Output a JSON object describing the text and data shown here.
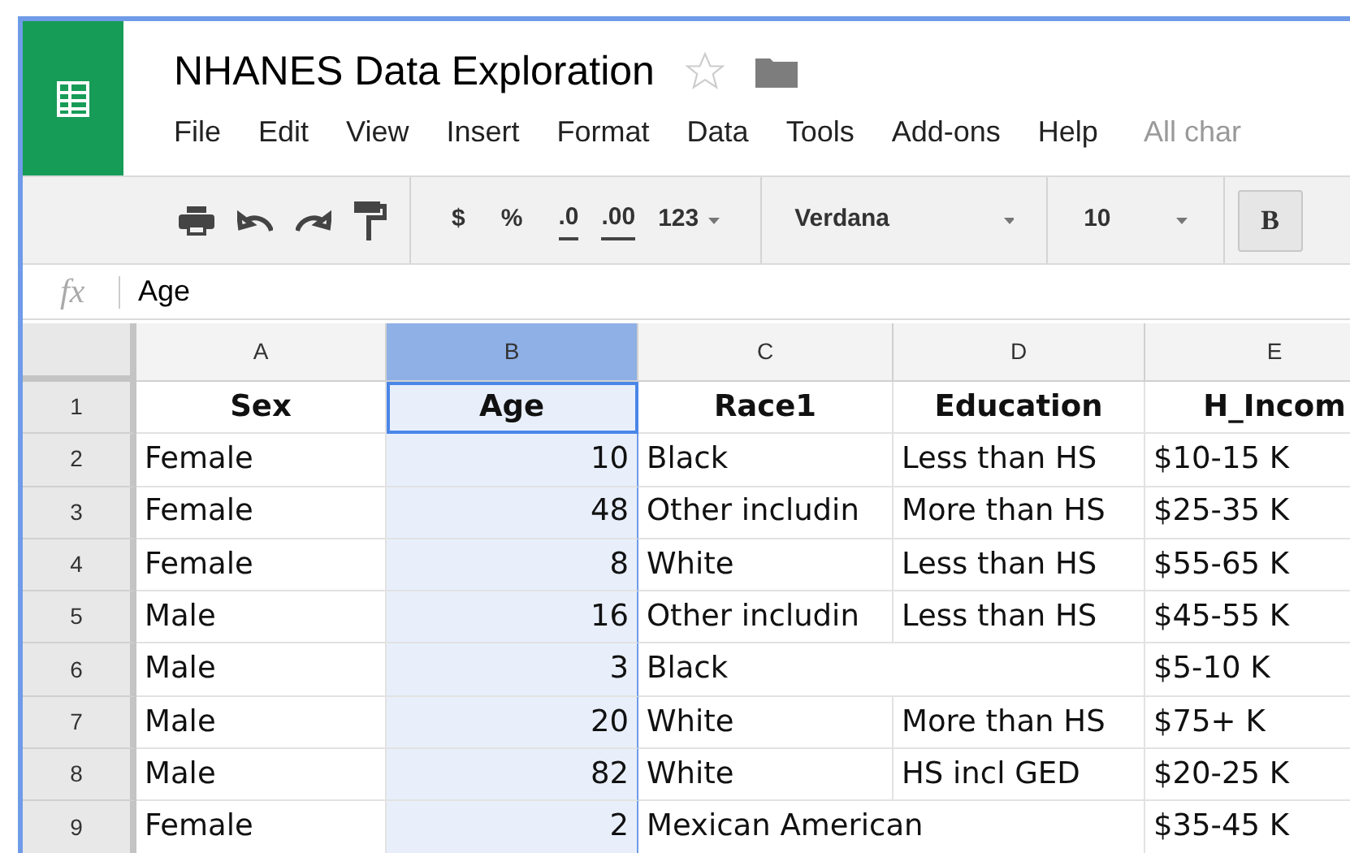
{
  "document": {
    "title": "NHANES Data Exploration",
    "starred": false
  },
  "menu": [
    "File",
    "Edit",
    "View",
    "Insert",
    "Format",
    "Data",
    "Tools",
    "Add-ons",
    "Help"
  ],
  "save_status": "All char",
  "toolbar": {
    "currency": "$",
    "percent": "%",
    "decrease_decimals": ".0",
    "increase_decimals": ".00",
    "more_formats": "123",
    "font": "Verdana",
    "font_size": "10",
    "bold": "B"
  },
  "formula_bar": {
    "label": "fx",
    "value": "Age"
  },
  "columns": [
    {
      "letter": "A",
      "kind": "text",
      "selected": false
    },
    {
      "letter": "B",
      "kind": "number",
      "selected": true
    },
    {
      "letter": "C",
      "kind": "text",
      "selected": false
    },
    {
      "letter": "D",
      "kind": "text",
      "selected": false
    },
    {
      "letter": "E",
      "kind": "text",
      "selected": false
    }
  ],
  "rows": [
    {
      "number": "1",
      "kind": "header",
      "active": true,
      "cells": [
        "Sex",
        "Age",
        "Race1",
        "Education",
        "H_Incom"
      ]
    },
    {
      "number": "2",
      "kind": "data",
      "active": false,
      "cells": [
        "Female",
        "10",
        "Black",
        "Less than HS",
        "$10-15 K"
      ]
    },
    {
      "number": "3",
      "kind": "data",
      "active": false,
      "cells": [
        "Female",
        "48",
        "Other includin",
        "More than HS",
        "$25-35 K"
      ]
    },
    {
      "number": "4",
      "kind": "data",
      "active": false,
      "cells": [
        "Female",
        "8",
        "White",
        "Less than HS",
        "$55-65 K"
      ]
    },
    {
      "number": "5",
      "kind": "data",
      "active": false,
      "cells": [
        "Male",
        "16",
        "Other includin",
        "Less than HS",
        "$45-55 K"
      ]
    },
    {
      "number": "6",
      "kind": "data",
      "active": false,
      "cells": [
        "Male",
        "3",
        "Black",
        "",
        "$5-10 K"
      ]
    },
    {
      "number": "7",
      "kind": "data",
      "active": false,
      "cells": [
        "Male",
        "20",
        "White",
        "More than HS",
        "$75+ K"
      ]
    },
    {
      "number": "8",
      "kind": "data",
      "active": false,
      "cells": [
        "Male",
        "82",
        "White",
        "HS incl GED",
        "$20-25 K"
      ]
    },
    {
      "number": "9",
      "kind": "data",
      "active": false,
      "cells": [
        "Female",
        "2",
        "Mexican American",
        "",
        "$35-45 K"
      ]
    }
  ]
}
